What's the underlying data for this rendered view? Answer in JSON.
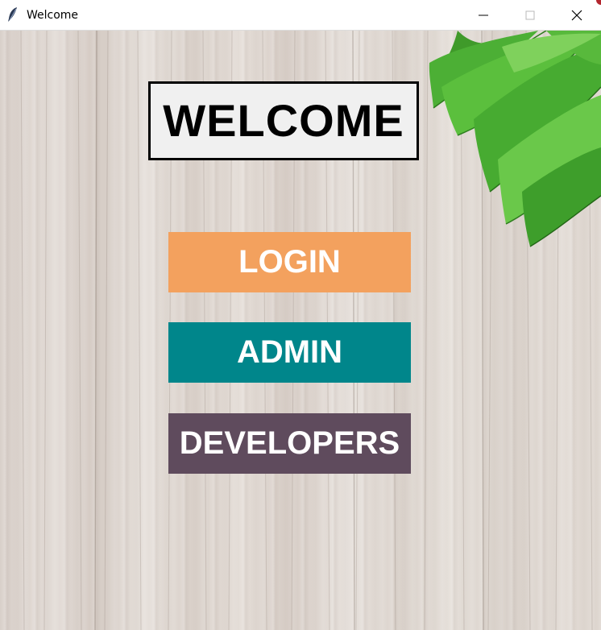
{
  "window": {
    "title": "Welcome",
    "icon": "feather-icon",
    "controls": [
      "minimize-icon",
      "maximize-icon",
      "close-icon"
    ]
  },
  "main": {
    "heading": "WELCOME",
    "buttons": {
      "login": "LOGIN",
      "admin": "ADMIN",
      "developers": "DEVELOPERS"
    }
  },
  "colors": {
    "login": "#f3a15e",
    "admin": "#00868b",
    "developers": "#5f4b5d",
    "heading_bg": "#f0f0f0",
    "button_text": "#ffffff"
  }
}
